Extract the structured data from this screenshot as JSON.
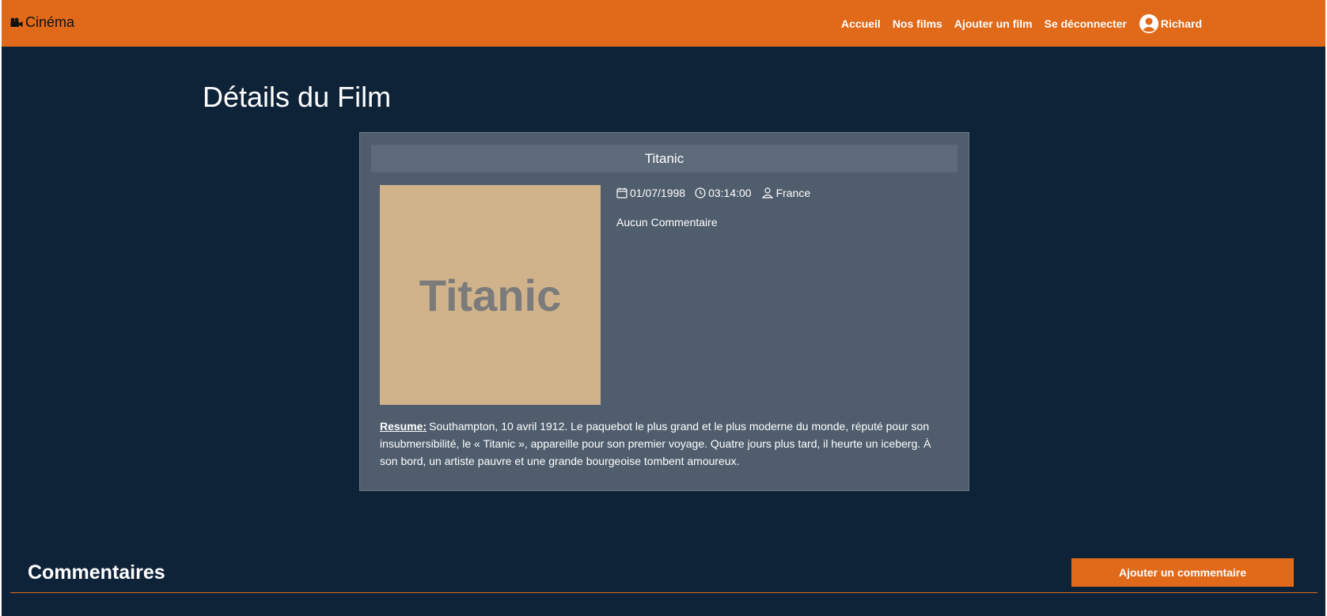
{
  "navbar": {
    "brand": "Cinéma",
    "brand_icon": "camera-icon",
    "links": [
      "Accueil",
      "Nos films",
      "Ajouter un film",
      "Se déconnecter"
    ],
    "user_name": "Richard",
    "user_icon": "user-avatar-icon",
    "accent_color": "#e0691a"
  },
  "page": {
    "title": "Détails du Film",
    "background_color": "#0f2338"
  },
  "film": {
    "title": "Titanic",
    "poster_text": "Titanic",
    "date": "01/07/1998",
    "duration": "03:14:00",
    "country": "France",
    "comments_status": "Aucun Commentaire",
    "resume_label": "Resume:",
    "resume": "Southampton, 10 avril 1912. Le paquebot le plus grand et le plus moderne du monde, réputé pour son insubmersibilité, le « Titanic », appareille pour son premier voyage. Quatre jours plus tard, il heurte un iceberg. À son bord, un artiste pauvre et une grande bourgeoise tombent amoureux."
  },
  "comments": {
    "title": "Commentaires",
    "add_button": "Ajouter un commentaire"
  }
}
